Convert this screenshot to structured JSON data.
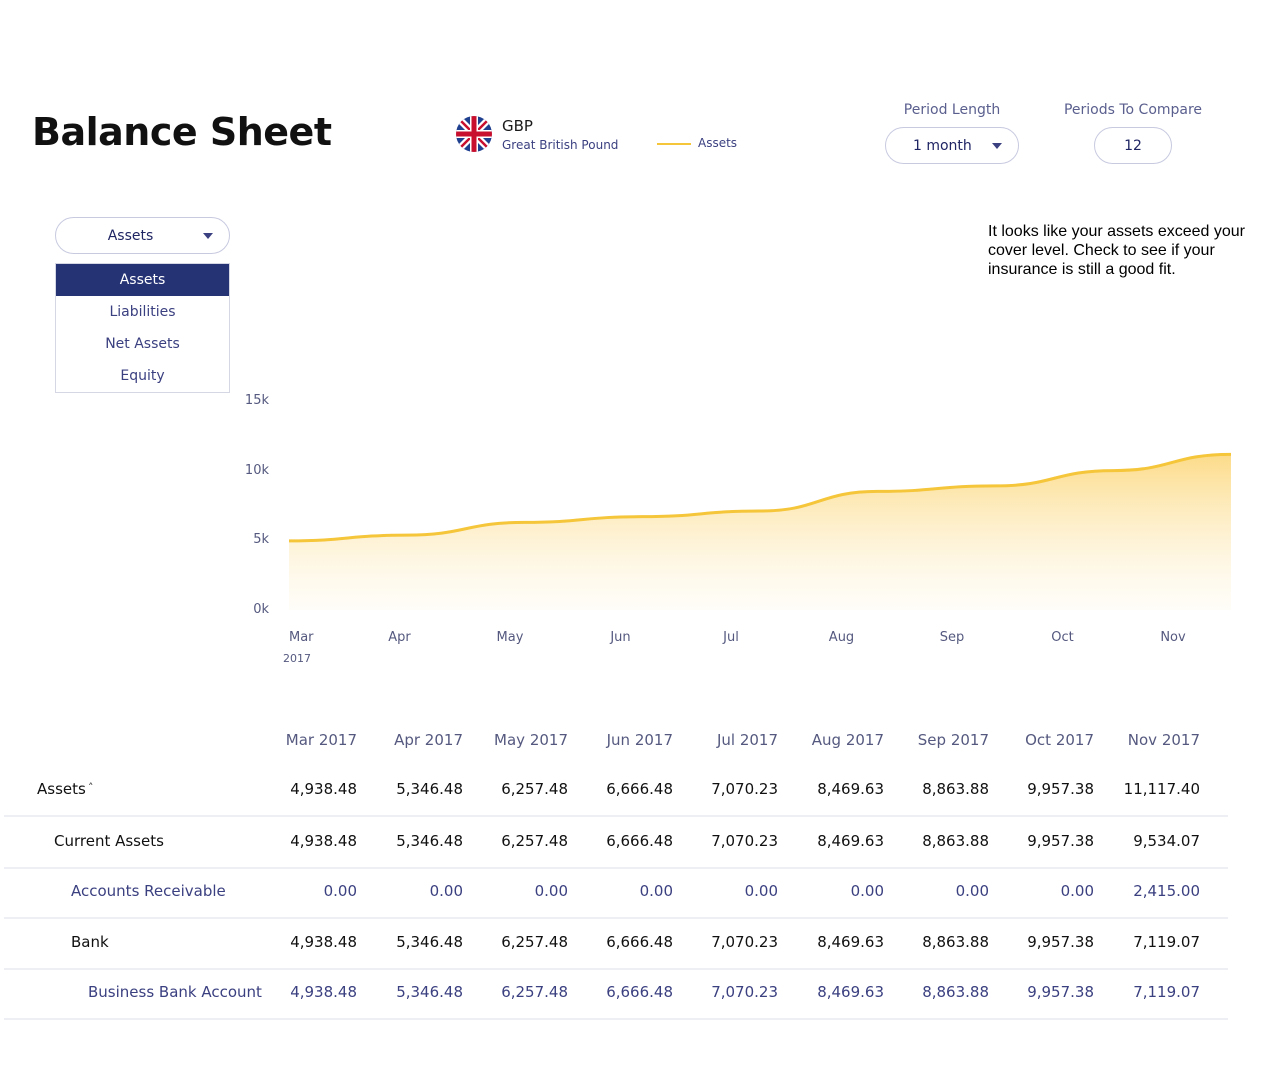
{
  "header": {
    "title": "Balance Sheet",
    "currency_code": "GBP",
    "currency_name": "Great British Pound",
    "legend_label": "Assets",
    "period_length_label": "Period Length",
    "period_length_value": "1 month",
    "periods_compare_label": "Periods To Compare",
    "periods_compare_value": "12"
  },
  "selector": {
    "selected": "Assets",
    "options": [
      "Assets",
      "Liabilities",
      "Net Assets",
      "Equity"
    ]
  },
  "notice": "It looks like your assets exceed your cover level. Check to see if your insurance is still a good fit.",
  "colors": {
    "accent": "#f5c53a",
    "navy": "#253375",
    "label": "#3b4080"
  },
  "chart_data": {
    "type": "area",
    "categories": [
      "Mar",
      "Apr",
      "May",
      "Jun",
      "Jul",
      "Aug",
      "Sep",
      "Oct",
      "Nov"
    ],
    "year_label": "2017",
    "series": [
      {
        "name": "Assets",
        "values": [
          4938.48,
          5346.48,
          6257.48,
          6666.48,
          7070.23,
          8469.63,
          8863.88,
          9957.38,
          11117.4
        ]
      }
    ],
    "y_ticks": [
      "15k",
      "10k",
      "5k",
      "0k"
    ],
    "ylim": [
      0,
      15000
    ],
    "grid": false
  },
  "table": {
    "columns": [
      "Mar 2017",
      "Apr 2017",
      "May 2017",
      "Jun 2017",
      "Jul 2017",
      "Aug 2017",
      "Sep 2017",
      "Oct 2017",
      "Nov 2017"
    ],
    "rows": [
      {
        "label": "Assets",
        "values": [
          "4,938.48",
          "5,346.48",
          "6,257.48",
          "6,666.48",
          "7,070.23",
          "8,469.63",
          "8,863.88",
          "9,957.38",
          "11,117.40"
        ]
      },
      {
        "label": "Current Assets",
        "values": [
          "4,938.48",
          "5,346.48",
          "6,257.48",
          "6,666.48",
          "7,070.23",
          "8,469.63",
          "8,863.88",
          "9,957.38",
          "9,534.07"
        ]
      },
      {
        "label": "Accounts Receivable",
        "values": [
          "0.00",
          "0.00",
          "0.00",
          "0.00",
          "0.00",
          "0.00",
          "0.00",
          "0.00",
          "2,415.00"
        ]
      },
      {
        "label": "Bank",
        "values": [
          "4,938.48",
          "5,346.48",
          "6,257.48",
          "6,666.48",
          "7,070.23",
          "8,469.63",
          "8,863.88",
          "9,957.38",
          "7,119.07"
        ]
      },
      {
        "label": "Business Bank Account",
        "values": [
          "4,938.48",
          "5,346.48",
          "6,257.48",
          "6,666.48",
          "7,070.23",
          "8,469.63",
          "8,863.88",
          "9,957.38",
          "7,119.07"
        ]
      }
    ]
  }
}
